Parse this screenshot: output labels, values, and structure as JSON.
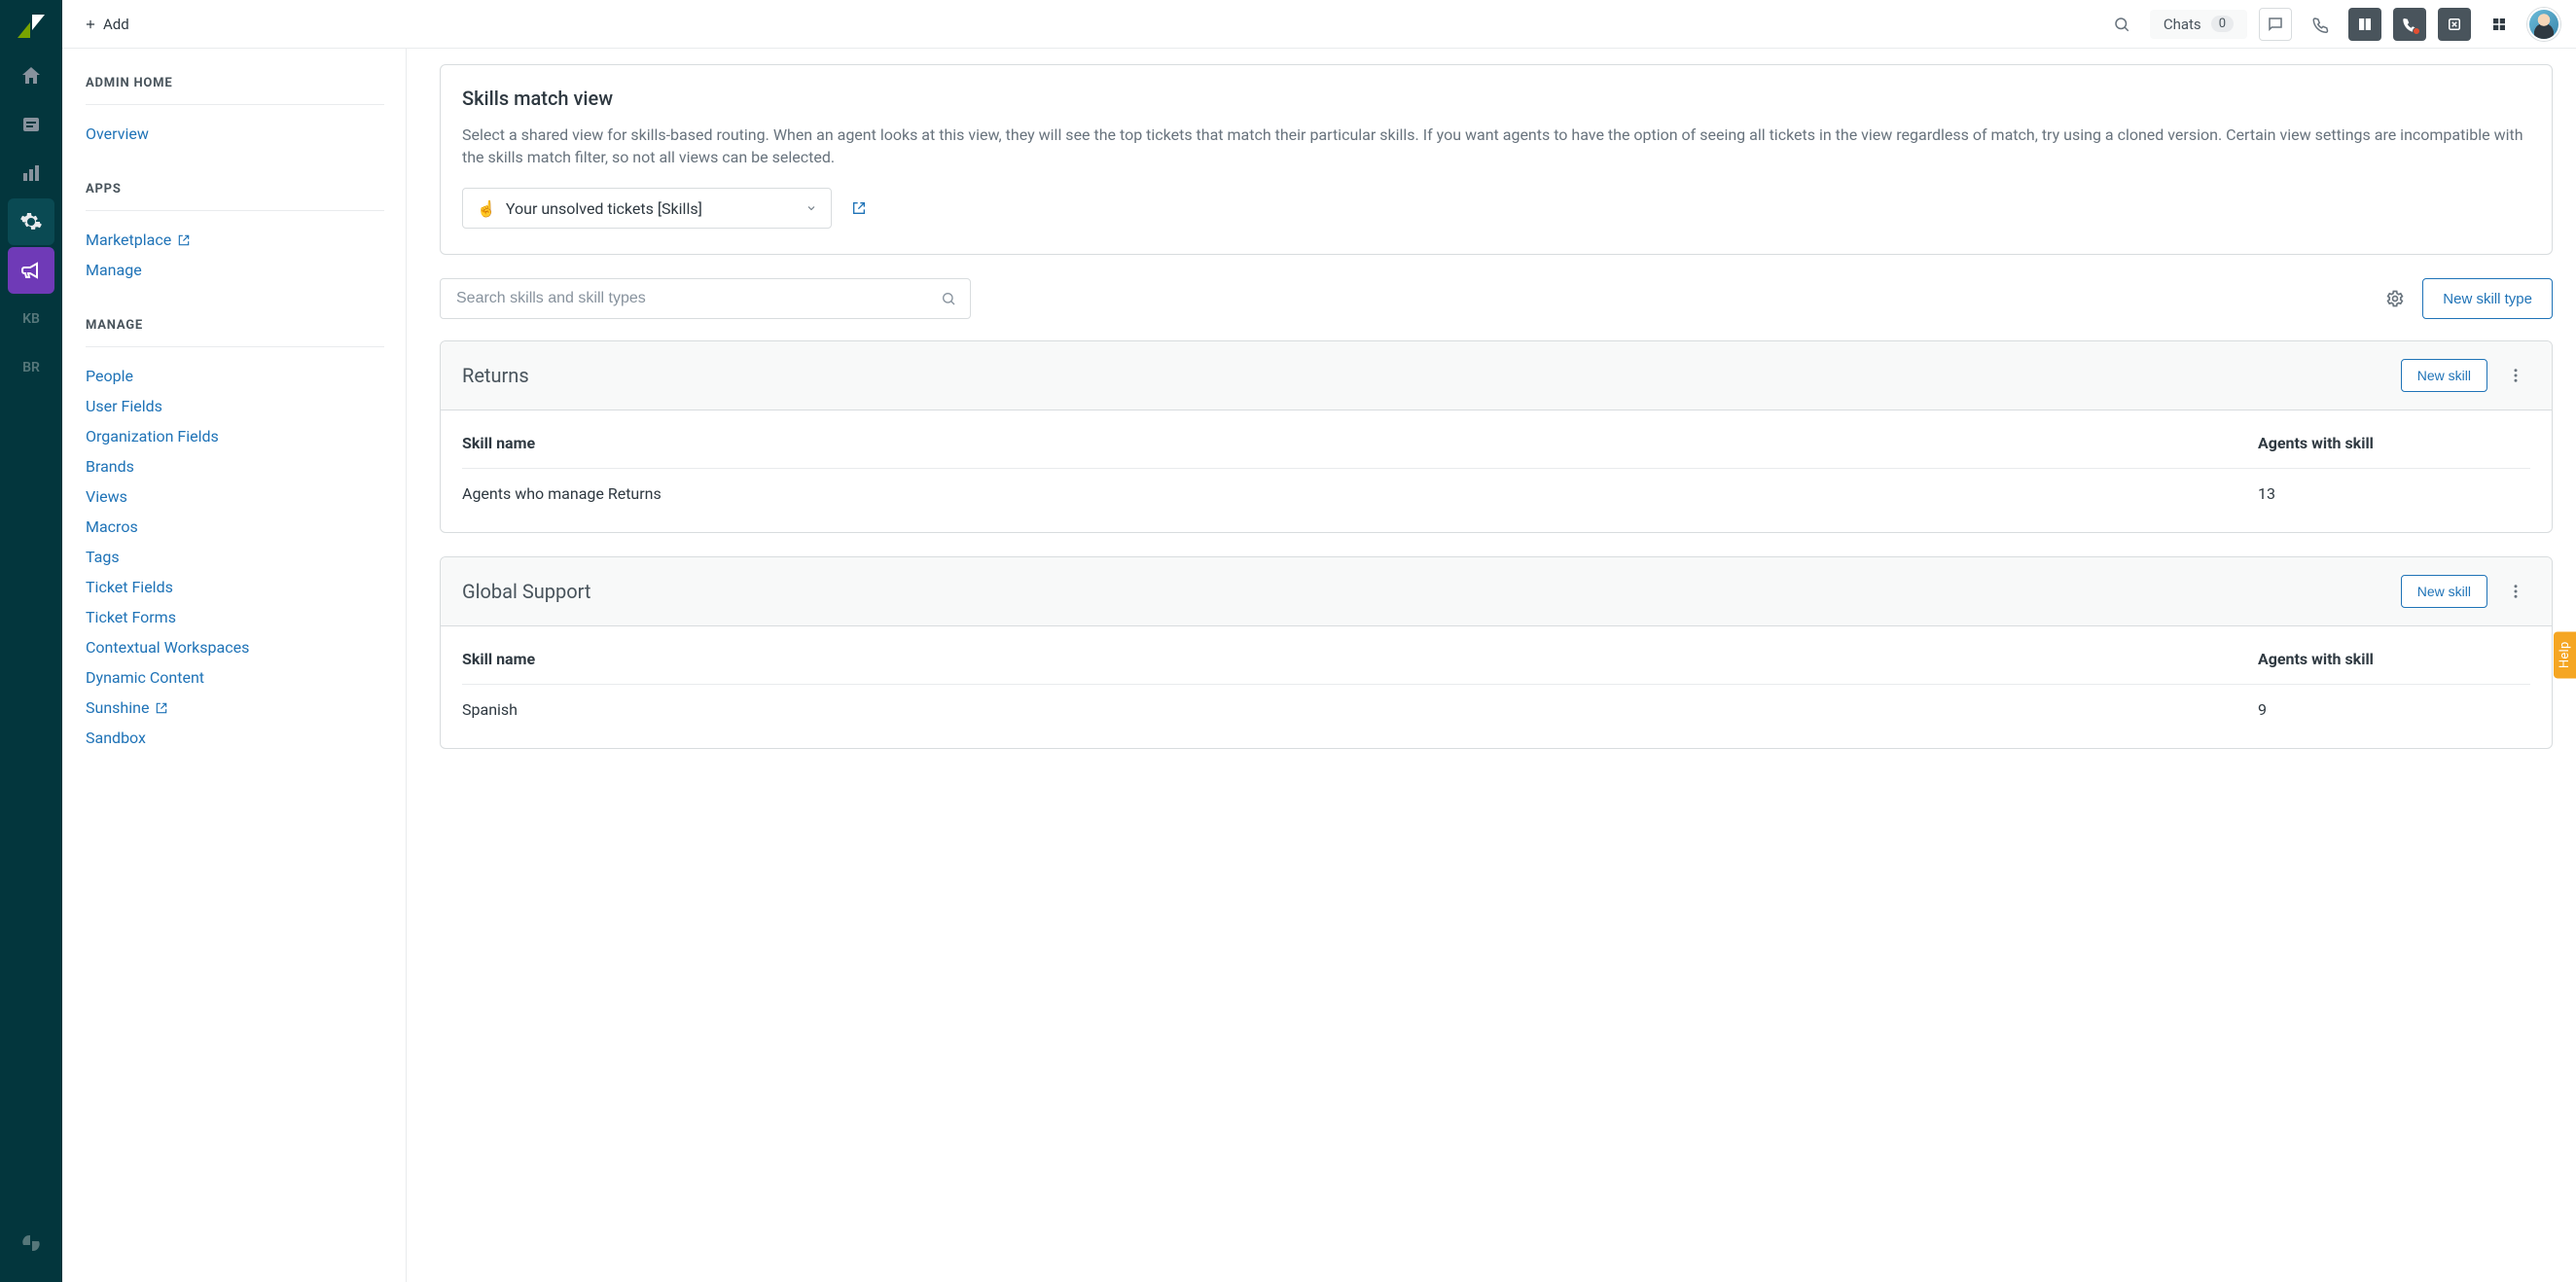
{
  "topbar": {
    "add_label": "Add",
    "chats_label": "Chats",
    "chats_count": "0"
  },
  "sidebar": {
    "section_admin": "ADMIN HOME",
    "overview": "Overview",
    "section_apps": "APPS",
    "marketplace": "Marketplace",
    "manage_app": "Manage",
    "section_manage": "MANAGE",
    "links": {
      "people": "People",
      "user_fields": "User Fields",
      "org_fields": "Organization Fields",
      "brands": "Brands",
      "views": "Views",
      "macros": "Macros",
      "tags": "Tags",
      "ticket_fields": "Ticket Fields",
      "ticket_forms": "Ticket Forms",
      "contextual_workspaces": "Contextual Workspaces",
      "dynamic_content": "Dynamic Content",
      "sunshine": "Sunshine",
      "sandbox": "Sandbox"
    }
  },
  "rail": {
    "kb": "KB",
    "br": "BR"
  },
  "skills_panel": {
    "title": "Skills match view",
    "description": "Select a shared view for skills-based routing. When an agent looks at this view, they will see the top tickets that match their particular skills. If you want agents to have the option of seeing all tickets in the view regardless of match, try using a cloned version. Certain view settings are incompatible with the skills match filter, so not all views can be selected.",
    "select_emoji": "☝️",
    "select_value": "Your unsolved tickets [Skills]"
  },
  "tools": {
    "search_placeholder": "Search skills and skill types",
    "new_type_label": "New skill type"
  },
  "groups": [
    {
      "name": "Returns",
      "new_skill_label": "New skill",
      "header_skill": "Skill name",
      "header_agents": "Agents with skill",
      "rows": [
        {
          "name": "Agents who manage Returns",
          "count": "13"
        }
      ]
    },
    {
      "name": "Global Support",
      "new_skill_label": "New skill",
      "header_skill": "Skill name",
      "header_agents": "Agents with skill",
      "rows": [
        {
          "name": "Spanish",
          "count": "9"
        }
      ]
    }
  ],
  "help_label": "Help"
}
